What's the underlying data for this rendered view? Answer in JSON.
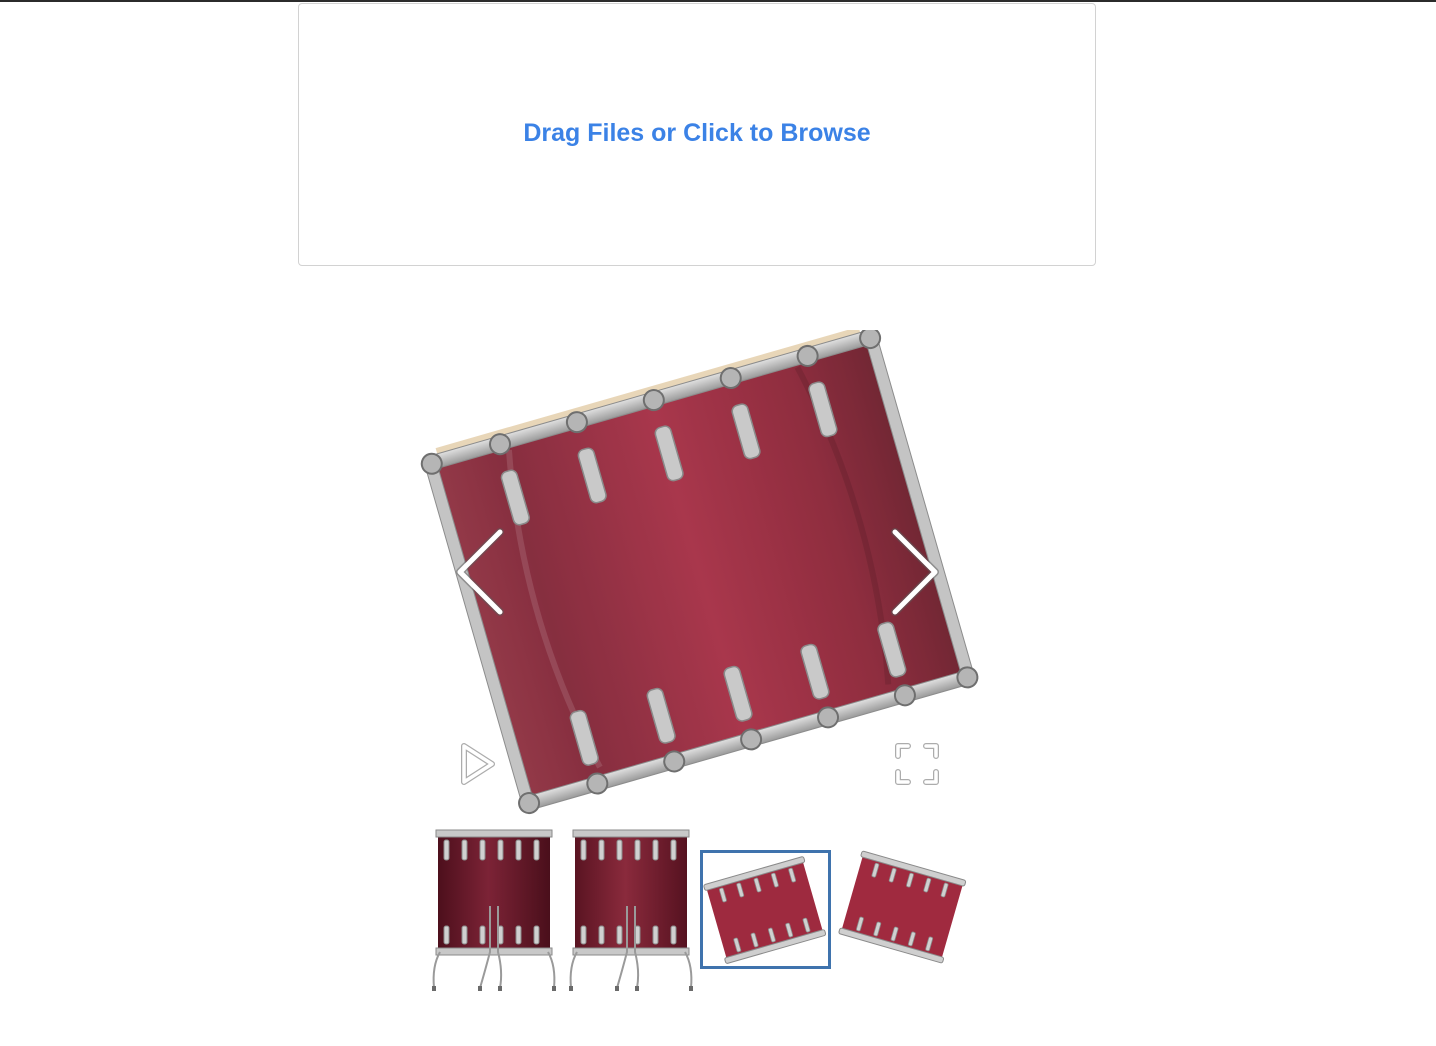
{
  "uploader": {
    "label": "Drag Files or Click to Browse"
  },
  "gallery": {
    "prev_icon": "chevron-left-icon",
    "next_icon": "chevron-right-icon",
    "play_icon": "play-icon",
    "fullscreen_icon": "fullscreen-icon",
    "active_thumb_index": 2,
    "thumbnails": [
      {
        "subject": "drum-front-with-legs"
      },
      {
        "subject": "drum-front-with-legs"
      },
      {
        "subject": "drum-tilted-left"
      },
      {
        "subject": "drum-tilted-right"
      }
    ]
  },
  "colors": {
    "link_blue": "#3b82e6",
    "active_border": "#3f73ad",
    "drum_red": "#a02a3d"
  }
}
